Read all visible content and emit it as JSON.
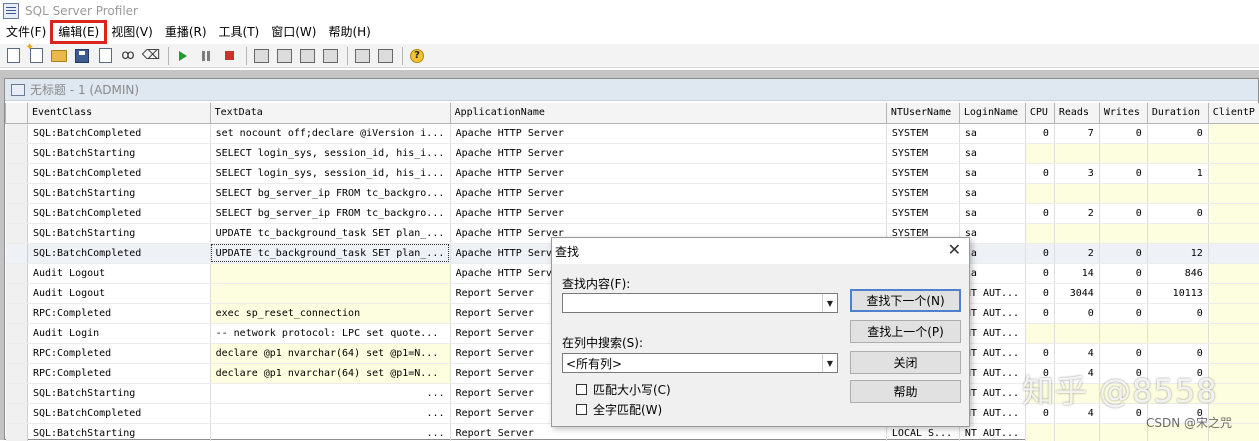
{
  "app": {
    "title": "SQL Server Profiler"
  },
  "menu": [
    "文件(F)",
    "编辑(E)",
    "视图(V)",
    "重播(R)",
    "工具(T)",
    "窗口(W)",
    "帮助(H)"
  ],
  "trace_window": {
    "title": "无标题 - 1 (ADMIN)"
  },
  "grid": {
    "columns": [
      "EventClass",
      "TextData",
      "ApplicationName",
      "NTUserName",
      "LoginName",
      "CPU",
      "Reads",
      "Writes",
      "Duration",
      "ClientP"
    ],
    "rows": [
      [
        "SQL:BatchCompleted",
        "set nocount off;declare @iVersion i...",
        "Apache HTTP Server",
        "SYSTEM",
        "sa",
        "0",
        "7",
        "0",
        "0",
        ""
      ],
      [
        "SQL:BatchStarting",
        "SELECT login_sys, session_id, his_i...",
        "Apache HTTP Server",
        "SYSTEM",
        "sa",
        "",
        "",
        "",
        "",
        ""
      ],
      [
        "SQL:BatchCompleted",
        "SELECT login_sys, session_id, his_i...",
        "Apache HTTP Server",
        "SYSTEM",
        "sa",
        "0",
        "3",
        "0",
        "1",
        ""
      ],
      [
        "SQL:BatchStarting",
        "SELECT bg_server_ip FROM tc_backgro...",
        "Apache HTTP Server",
        "SYSTEM",
        "sa",
        "",
        "",
        "",
        "",
        ""
      ],
      [
        "SQL:BatchCompleted",
        "SELECT bg_server_ip FROM tc_backgro...",
        "Apache HTTP Server",
        "SYSTEM",
        "sa",
        "0",
        "2",
        "0",
        "0",
        ""
      ],
      [
        "SQL:BatchStarting",
        "UPDATE tc_background_task SET plan_...",
        "Apache HTTP Server",
        "SYSTEM",
        "sa",
        "",
        "",
        "",
        "",
        ""
      ],
      [
        "SQL:BatchCompleted",
        "UPDATE tc_background_task SET plan_...",
        "Apache HTTP Server",
        "",
        "sa",
        "0",
        "2",
        "0",
        "12",
        ""
      ],
      [
        "Audit Logout",
        "",
        "Apache HTTP Serv",
        "",
        "sa",
        "0",
        "14",
        "0",
        "846",
        ""
      ],
      [
        "Audit Logout",
        "",
        "Report Server",
        "",
        "NT AUT...",
        "0",
        "3044",
        "0",
        "10113",
        ""
      ],
      [
        "RPC:Completed",
        "exec sp_reset_connection",
        "Report Server",
        "",
        "NT AUT...",
        "0",
        "0",
        "0",
        "0",
        ""
      ],
      [
        "Audit Login",
        "-- network protocol: LPC  set quote...",
        "Report Server",
        "",
        "NT AUT...",
        "",
        "",
        "",
        "",
        ""
      ],
      [
        "RPC:Completed",
        "declare @p1 nvarchar(64)  set @p1=N...",
        "Report Server",
        "",
        "NT AUT...",
        "0",
        "4",
        "0",
        "0",
        ""
      ],
      [
        "RPC:Completed",
        "declare @p1 nvarchar(64)  set @p1=N...",
        "Report Server",
        "",
        "NT AUT...",
        "0",
        "4",
        "0",
        "0",
        ""
      ],
      [
        "SQL:BatchStarting",
        "...",
        "Report Server",
        "",
        "NT AUT...",
        "",
        "",
        "",
        "",
        ""
      ],
      [
        "SQL:BatchCompleted",
        "...",
        "Report Server",
        "",
        "NT AUT...",
        "0",
        "4",
        "0",
        "0",
        ""
      ],
      [
        "SQL:BatchStarting",
        "...",
        "Report Server",
        "LOCAL S...",
        "NT AUT...",
        "",
        "",
        "",
        "",
        ""
      ]
    ]
  },
  "find_dialog": {
    "title": "查找",
    "find_what_label": "查找内容(F):",
    "find_what_value": "",
    "search_in_label": "在列中搜索(S):",
    "search_in_value": "<所有列>",
    "match_case_label": "匹配大小写(C)",
    "whole_word_label": "全字匹配(W)",
    "buttons": {
      "find_next": "查找下一个(N)",
      "find_prev": "查找上一个(P)",
      "close": "关闭",
      "help": "帮助"
    }
  },
  "watermark": {
    "main": "知乎 @8558",
    "sub": "CSDN @宋之咒"
  }
}
